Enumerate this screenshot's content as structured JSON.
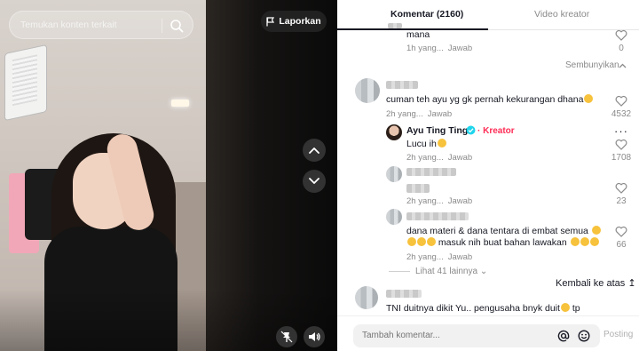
{
  "video": {
    "search_placeholder": "Temukan konten terkait",
    "report_label": "Laporkan"
  },
  "panel": {
    "tabs": [
      {
        "label": "Komentar (2160)",
        "active": true
      },
      {
        "label": "Video kreator",
        "active": false
      }
    ],
    "comments": [
      {
        "text": "mana",
        "time": "1h yang...",
        "reply": "Jawab",
        "likes": "0"
      },
      {
        "hide_label": "Sembunyikan"
      },
      {
        "text": "cuman teh ayu yg gk pernah kekurangan dhana",
        "time": "2h yang...",
        "reply": "Jawab",
        "likes": "4532"
      },
      {
        "author": "Ayu Ting Ting",
        "badge": "Kreator",
        "text": "Lucu ih",
        "time": "2h yang...",
        "reply": "Jawab",
        "likes": "1708"
      },
      {
        "text": "",
        "time": "2h yang...",
        "reply": "Jawab",
        "likes": "23"
      },
      {
        "text_line1": "dana materi & dana tentara di embat semua",
        "text_line2": "masuk nih buat bahan lawakan",
        "time": "2h yang...",
        "reply": "Jawab",
        "likes": "66"
      },
      {
        "text": "TNI duitnya dikit Yu.. pengusaha bnyk duit",
        "text_tail": "tp"
      }
    ],
    "view_more": "Lihat 41 lainnya",
    "back_to_top": "Kembali ke atas",
    "composer_placeholder": "Tambah komentar...",
    "post_label": "Posting"
  },
  "colors": {
    "accent": "#fe2c55",
    "text": "#161823",
    "muted": "#8a8a8a",
    "verified": "#20d5ec"
  },
  "icons": [
    "search-icon",
    "flag-icon",
    "chevron-up-icon",
    "chevron-down-icon",
    "pin-icon",
    "volume-icon",
    "heart-icon",
    "verified-icon",
    "more-icon",
    "at-icon",
    "emoji-icon"
  ]
}
